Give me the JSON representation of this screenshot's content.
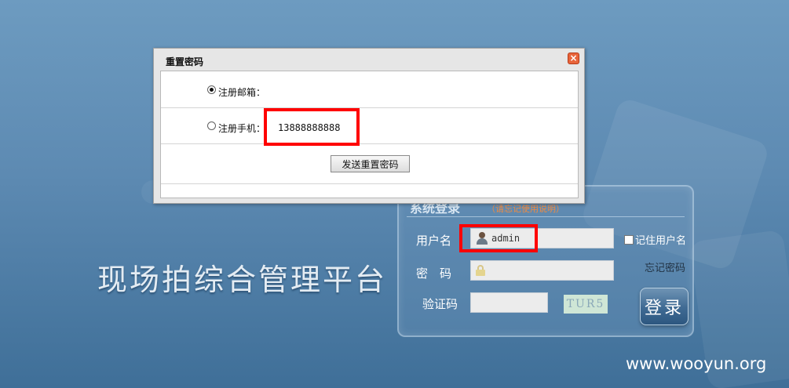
{
  "platform": {
    "title": "现场拍综合管理平台",
    "watermark": "www.wooyun.org"
  },
  "login": {
    "title": "系统登录",
    "note": "（请忘记使用说明）",
    "username_label": "用户名",
    "username_value": "admin",
    "password_label": "密　码",
    "captcha_label": "验证码",
    "captcha_text": "TUR5",
    "remember_label": "记住用户名",
    "forgot_label": "忘记密码",
    "login_button": "登录"
  },
  "dialog": {
    "title": "重置密码",
    "email_option_label": "注册邮箱：",
    "phone_option_label": "注册手机：",
    "phone_value": "13888888888",
    "send_button": "发送重置密码",
    "close_symbol": "×",
    "selected_option": "email"
  },
  "colors": {
    "background": "#5d8ab2",
    "highlight": "#ff0000",
    "note": "#f08a40"
  }
}
